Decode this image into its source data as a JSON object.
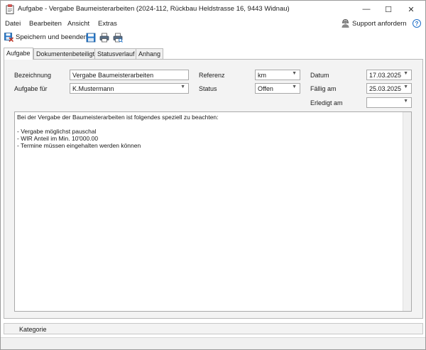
{
  "window": {
    "title": "Aufgabe - Vergabe Baumeisterarbeiten (2024-112, Rückbau Heldstrasse 16, 9443 Widnau)",
    "minimize_glyph": "—",
    "maximize_glyph": "☐",
    "close_glyph": "✕"
  },
  "menu": {
    "items": [
      "Datei",
      "Bearbeiten",
      "Ansicht",
      "Extras"
    ],
    "support_label": "Support anfordern",
    "help_glyph": "?"
  },
  "toolbar": {
    "save_close_label": "Speichern und beenden"
  },
  "tabs": [
    "Aufgabe",
    "Dokumentenbeteiligte",
    "Statusverlauf",
    "Anhang"
  ],
  "form": {
    "bezeichnung_label": "Bezeichnung",
    "bezeichnung_value": "Vergabe Baumeisterarbeiten",
    "aufgabe_fuer_label": "Aufgabe für",
    "aufgabe_fuer_value": "K.Mustermann",
    "referenz_label": "Referenz",
    "referenz_value": "km",
    "status_label": "Status",
    "status_value": "Offen",
    "datum_label": "Datum",
    "datum_value": "17.03.2025",
    "faellig_label": "Fällig am",
    "faellig_value": "25.03.2025",
    "erledigt_label": "Erledigt am",
    "erledigt_value": ""
  },
  "memo": {
    "lines": [
      "Bei der Vergabe der Baumeisterarbeiten ist folgendes speziell zu beachten:",
      "",
      "- Vergabe möglichst pauschal",
      "- WIR Anteil im Min. 10'000.00",
      "- Termine müssen eingehalten werden können"
    ]
  },
  "category": {
    "label": "Kategorie"
  },
  "colors": {
    "accent": "#1e6ec8",
    "panel_bg": "#f3f3f3",
    "border": "#a9a9a9"
  },
  "icons": [
    "app-task-icon",
    "support-person-icon",
    "help-icon",
    "save-close-icon",
    "save-icon",
    "print-icon",
    "print-preview-icon",
    "dropdown-arrow-icon"
  ]
}
